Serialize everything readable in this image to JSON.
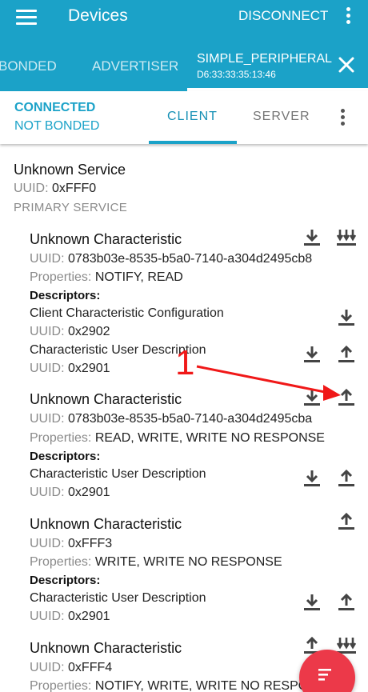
{
  "app_bar": {
    "title": "Devices",
    "disconnect_label": "DISCONNECT",
    "menu_icon": "hamburger-menu-icon",
    "overflow_icon": "more-vert-icon"
  },
  "device_tabs": {
    "tabs": [
      "BONDED",
      "ADVERTISER"
    ],
    "selected": {
      "name": "SIMPLE_PERIPHERAL",
      "address": "D6:33:33:35:13:46"
    },
    "close_icon": "close-icon"
  },
  "connection": {
    "state": "CONNECTED",
    "bond_state": "NOT BONDED",
    "tabs": [
      "CLIENT",
      "SERVER"
    ],
    "selected_tab": "CLIENT"
  },
  "service": {
    "name": "Unknown Service",
    "uuid_label": "UUID:",
    "uuid": "0xFFF0",
    "type": "PRIMARY SERVICE"
  },
  "characteristics": [
    {
      "name": "Unknown Characteristic",
      "uuid_label": "UUID:",
      "uuid": "0783b03e-8535-b5a0-7140-a304d2495cb8",
      "properties_label": "Properties:",
      "properties": "NOTIFY, READ",
      "descriptors_label": "Descriptors:",
      "descriptors": [
        {
          "name": "Client Characteristic Configuration",
          "uuid_label": "UUID:",
          "uuid": "0x2902"
        },
        {
          "name": "Characteristic User Description",
          "uuid_label": "UUID:",
          "uuid": "0x2901"
        }
      ]
    },
    {
      "name": "Unknown Characteristic",
      "uuid_label": "UUID:",
      "uuid": "0783b03e-8535-b5a0-7140-a304d2495cba",
      "properties_label": "Properties:",
      "properties": "READ, WRITE, WRITE NO RESPONSE",
      "descriptors_label": "Descriptors:",
      "descriptors": [
        {
          "name": "Characteristic User Description",
          "uuid_label": "UUID:",
          "uuid": "0x2901"
        }
      ]
    },
    {
      "name": "Unknown Characteristic",
      "uuid_label": "UUID:",
      "uuid": "0xFFF3",
      "properties_label": "Properties:",
      "properties": "WRITE, WRITE NO RESPONSE",
      "descriptors_label": "Descriptors:",
      "descriptors": [
        {
          "name": "Characteristic User Description",
          "uuid_label": "UUID:",
          "uuid": "0x2901"
        }
      ]
    },
    {
      "name": "Unknown Characteristic",
      "uuid_label": "UUID:",
      "uuid": "0xFFF4",
      "properties_label": "Properties:",
      "properties": "NOTIFY, WRITE, WRITE NO RESPONSE"
    }
  ],
  "annotation": {
    "label": "1",
    "color": "#f01818"
  },
  "colors": {
    "primary": "#1ba2c8",
    "fab": "#ec3949",
    "icon": "#444444"
  },
  "fab_icon": "sort-list-icon"
}
